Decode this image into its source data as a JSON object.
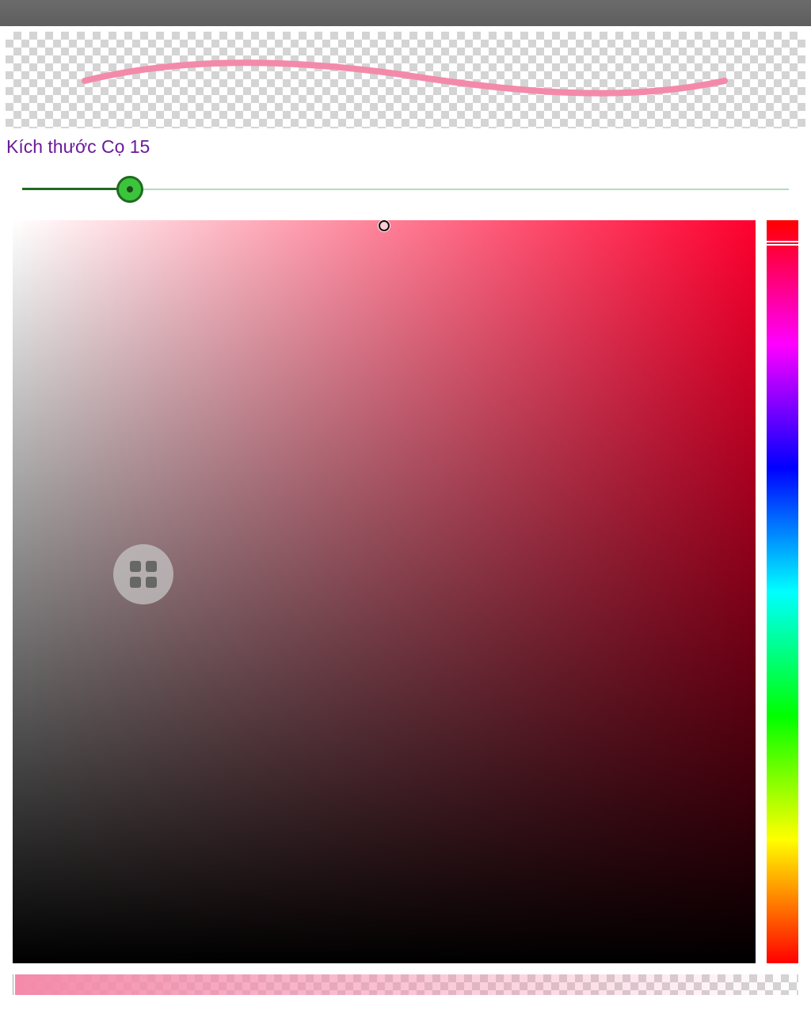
{
  "brush_preview": {
    "color": "#f48aaa"
  },
  "brush_size": {
    "label": "Kích thước Cọ 15",
    "value": 15,
    "fraction": 0.141
  },
  "color_picker": {
    "hue_degrees": 349,
    "saturation": 0.5,
    "value": 1.0,
    "alpha": 1.0,
    "selected_color": "#f48aaa"
  },
  "floating_button": {
    "icon": "grid-icon"
  }
}
